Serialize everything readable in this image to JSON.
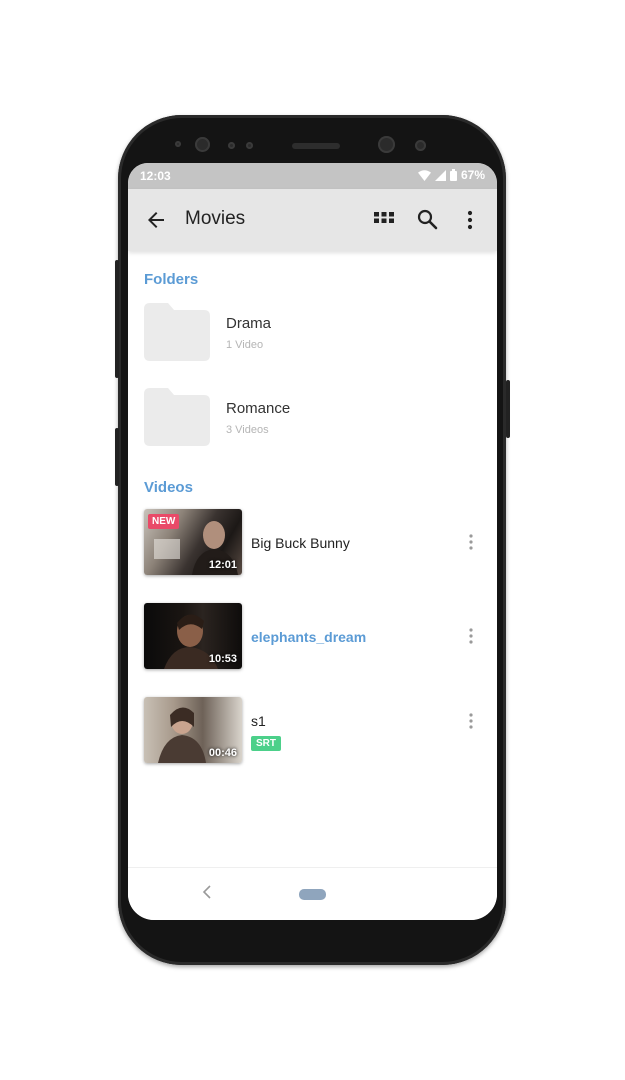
{
  "status_bar": {
    "time": "12:03",
    "battery": "67%"
  },
  "app_bar": {
    "title": "Movies",
    "back_icon": "arrow-back-icon",
    "grid_icon": "grid-view-icon",
    "search_icon": "search-icon",
    "more_icon": "more-vert-icon"
  },
  "sections": {
    "folders": "Folders",
    "videos": "Videos"
  },
  "folders": [
    {
      "name": "Drama",
      "count": "1 Video"
    },
    {
      "name": "Romance",
      "count": "3 Videos"
    }
  ],
  "videos": [
    {
      "title": "Big Buck Bunny",
      "duration": "12:01",
      "badge": "NEW"
    },
    {
      "title": "elephants_dream",
      "duration": "10:53"
    },
    {
      "title": "s1",
      "duration": "00:46",
      "tag": "SRT"
    }
  ],
  "colors": {
    "accent": "#5b9bd5",
    "new_badge": "#e94a68",
    "srt_badge": "#4cd08a"
  }
}
